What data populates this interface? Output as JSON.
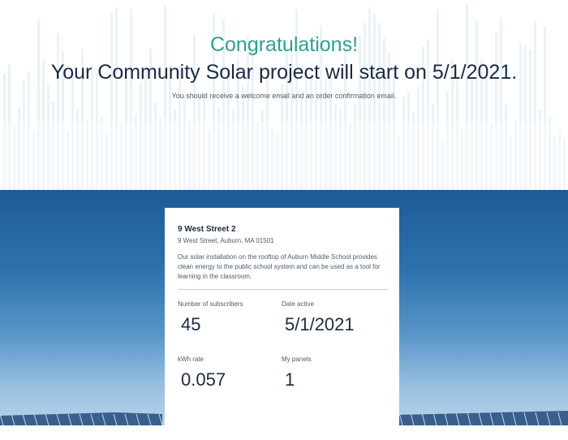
{
  "hero": {
    "congrats": "Congratulations!",
    "headline": "Your Community Solar project will start on 5/1/2021.",
    "subtext": "You should receive a welcome email and an order confirmation email."
  },
  "project": {
    "name": "9 West Street 2",
    "address": "9 West Street, Auburn, MA 01501",
    "description": "Our solar installation on the rooftop of Auburn Middle School provides clean energy to the public school system and can be used as a tool for learning in the classroom.",
    "stats": [
      {
        "label": "Number of subscribers",
        "value": "45"
      },
      {
        "label": "Date active",
        "value": "5/1/2021"
      },
      {
        "label": "kWh rate",
        "value": "0.057"
      },
      {
        "label": "My panels",
        "value": "1"
      }
    ]
  },
  "colors": {
    "accent": "#2f9f8a",
    "heading": "#1b2a44",
    "sky_top": "#1e5a96"
  }
}
